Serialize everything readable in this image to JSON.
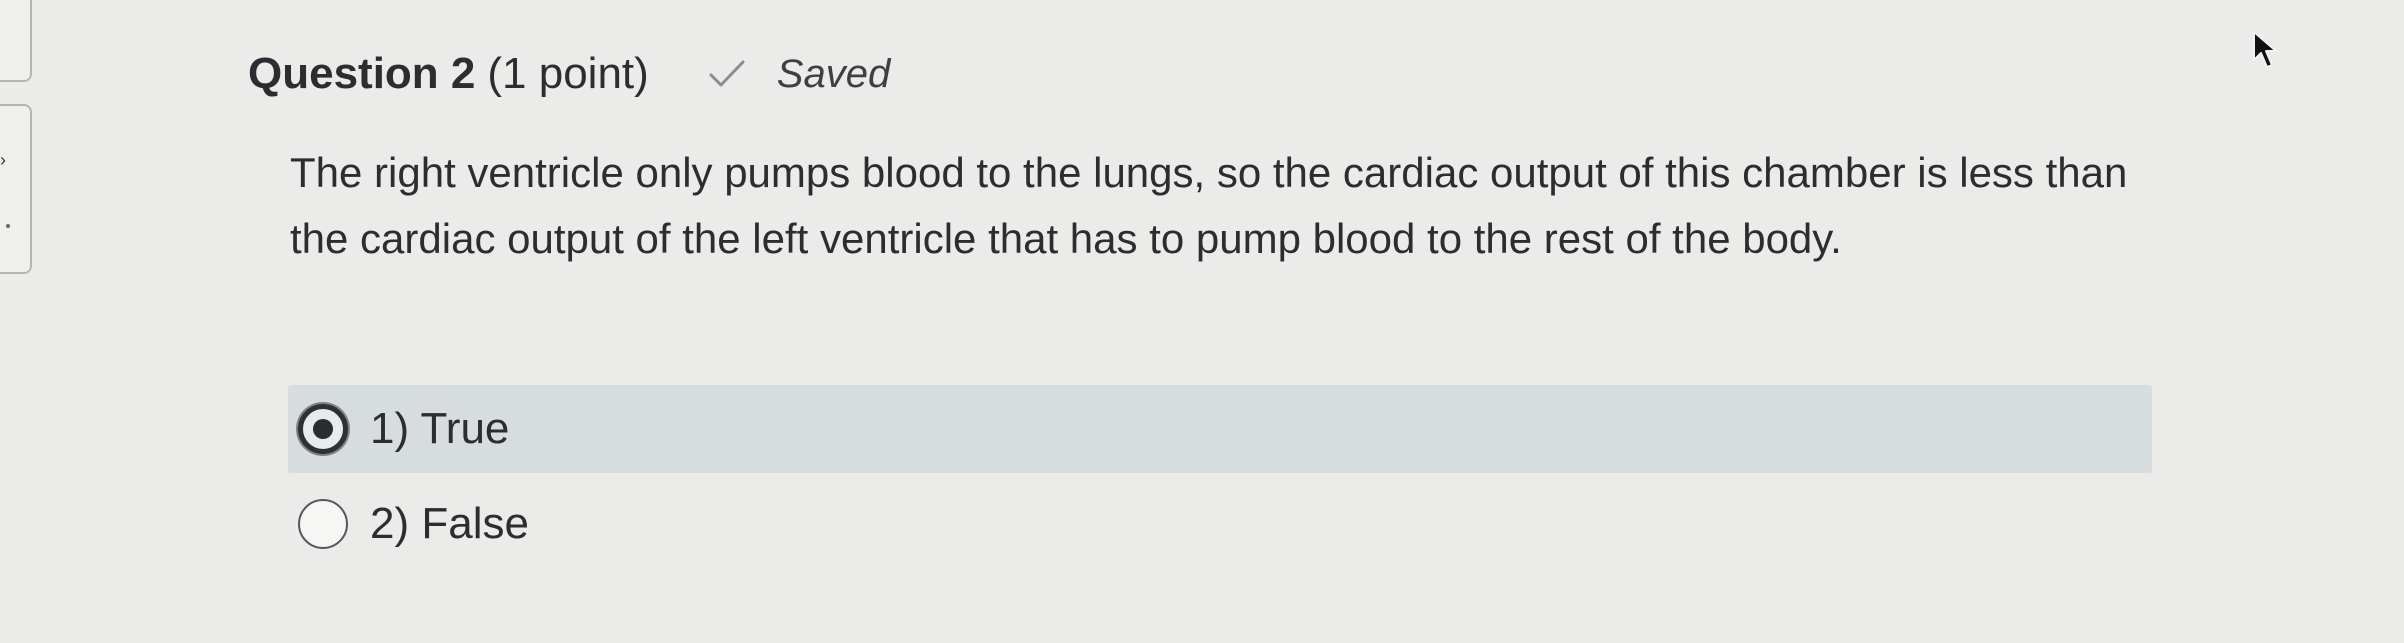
{
  "question": {
    "title": "Question 2",
    "points": "(1 point)",
    "saved_icon": "checkmark-icon",
    "saved_label": "Saved",
    "text": "The right ventricle only pumps blood to the lungs, so the cardiac output of this chamber is less than the cardiac output of the left ventricle that has to pump blood to the rest of the body."
  },
  "options": [
    {
      "label": "1) True",
      "selected": true
    },
    {
      "label": "2) False",
      "selected": false
    }
  ],
  "colors": {
    "selected_option_background": "#d7dcdf",
    "page_background": "#ebebe9",
    "text": "#2b2d30"
  },
  "cursor": "mouse-pointer-icon"
}
